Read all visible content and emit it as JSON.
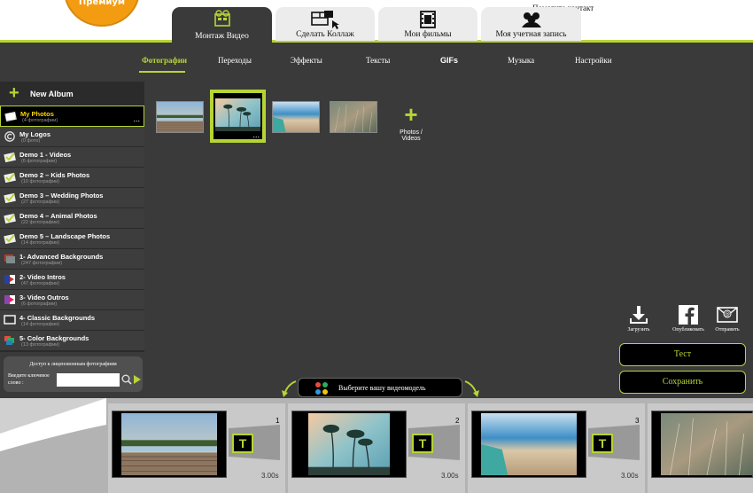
{
  "header": {
    "premium_label": "Премиум",
    "help_link": "Помогите",
    "contact_link": "контакт",
    "tabs": [
      {
        "label": "Монтаж Видео",
        "icon": "film-edit-icon",
        "active": true
      },
      {
        "label": "Сделать Коллаж",
        "icon": "collage-icon",
        "active": false
      },
      {
        "label": "Мои фильмы",
        "icon": "film-reel-icon",
        "active": false
      },
      {
        "label": "Моя учетная запись",
        "icon": "users-icon",
        "active": false
      }
    ]
  },
  "subnav": {
    "items": [
      {
        "label": "Фотографии",
        "active": true
      },
      {
        "label": "Переходы"
      },
      {
        "label": "Эффекты"
      },
      {
        "label": "Тексты"
      },
      {
        "label": "GIFs"
      },
      {
        "label": "Музыка"
      },
      {
        "label": "Настройки"
      }
    ]
  },
  "sidebar": {
    "new_album_label": "New Album",
    "albums": [
      {
        "name": "My Photos",
        "count": "(4 фотографии)",
        "selected": true,
        "more": "..."
      },
      {
        "name": "My Logos",
        "count": "(0 фото)"
      },
      {
        "name": "Demo 1 - Videos",
        "count": "(6 фотографии)"
      },
      {
        "name": "Demo 2 – Kids Photos",
        "count": "(10 фотографии)"
      },
      {
        "name": "Demo 3 – Wedding Photos",
        "count": "(27 фотографии)"
      },
      {
        "name": "Demo 4 – Animal Photos",
        "count": "(22 фотографии)"
      },
      {
        "name": "Demo 5 – Landscape Photos",
        "count": "(14 фотографии)"
      },
      {
        "name": "1- Advanced Backgrounds",
        "count": "(247 фотографии)"
      },
      {
        "name": "2- Video Intros",
        "count": "(47 фотографии)"
      },
      {
        "name": "3- Video Outros",
        "count": "(6 фотографии)"
      },
      {
        "name": "4- Classic Backgrounds",
        "count": "(14 фотографии)"
      },
      {
        "name": "5- Color Backgrounds",
        "count": "(13 фотографии)"
      }
    ],
    "search": {
      "title": "Доступ к лицензионным фотографиям",
      "label_line1": "Введите ключевое",
      "label_line2": "слово :",
      "value": ""
    }
  },
  "workspace": {
    "thumbnails": [
      {
        "scene": "pier",
        "selected": false
      },
      {
        "scene": "palms",
        "selected": true,
        "more": "..."
      },
      {
        "scene": "beach",
        "selected": false
      },
      {
        "scene": "grass",
        "selected": false
      }
    ],
    "add_label_line1": "Photos /",
    "add_label_line2": "Videos"
  },
  "actions": {
    "download_label": "Загрузить",
    "publish_label": "Опубликовать",
    "send_label": "Отправить",
    "test_label": "Тест",
    "save_label": "Сохранить"
  },
  "model_bar": {
    "label": "Выберите вашу видеомодель"
  },
  "storyboard": {
    "slots": [
      {
        "number": "1",
        "duration": "3.00s",
        "scene": "pier",
        "transition": "T"
      },
      {
        "number": "2",
        "duration": "3.00s",
        "scene": "palms",
        "transition": "T"
      },
      {
        "number": "3",
        "duration": "3.00s",
        "scene": "beach",
        "transition": "T"
      },
      {
        "number": "",
        "duration": "",
        "scene": "grass",
        "transition": ""
      }
    ]
  },
  "colors": {
    "accent": "#b6d534",
    "premium": "#f39c12",
    "panel": "#3a3a3a"
  }
}
